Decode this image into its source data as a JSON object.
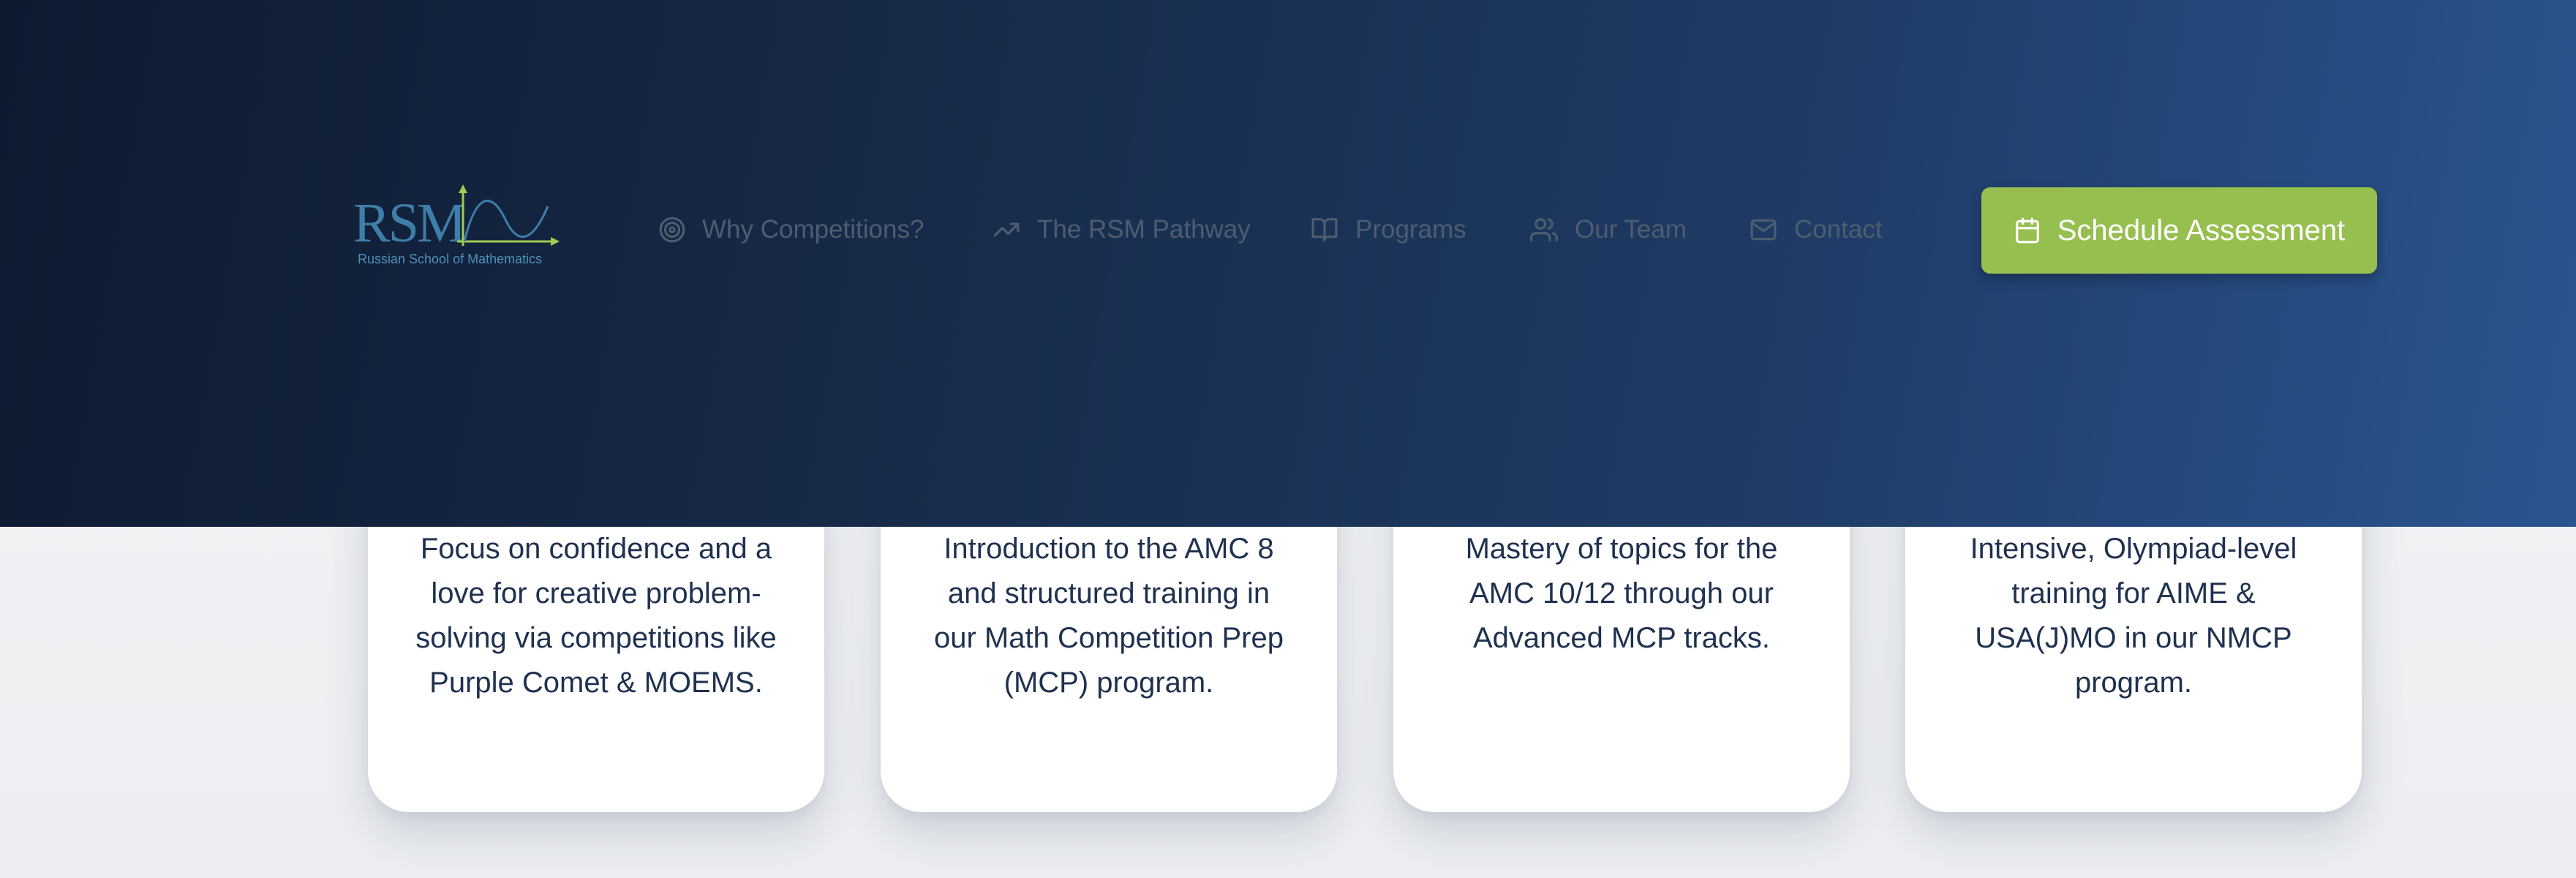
{
  "brand": {
    "logo_text": "RSM",
    "logo_subtitle": "Russian School of Mathematics",
    "colors": {
      "logo_blue": "#3e7ea8",
      "logo_green": "#9fcc52"
    }
  },
  "nav": {
    "items": [
      {
        "label": "Why Competitions?",
        "icon": "target-icon"
      },
      {
        "label": "The RSM Pathway",
        "icon": "trending-up-icon"
      },
      {
        "label": "Programs",
        "icon": "book-open-icon"
      },
      {
        "label": "Our Team",
        "icon": "users-icon"
      },
      {
        "label": "Contact",
        "icon": "mail-icon"
      }
    ]
  },
  "cta": {
    "label": "Schedule Assessment",
    "icon": "calendar-icon",
    "color": "#97bf4f"
  },
  "cards": [
    {
      "text": "Focus on confidence and a love for creative problem-solving via competitions like Purple Comet & MOEMS."
    },
    {
      "text": "Introduction to the AMC 8 and structured training in our Math Competition Prep (MCP) program."
    },
    {
      "text": "Mastery of topics for the AMC 10/12 through our Advanced MCP tracks."
    },
    {
      "text": "Intensive, Olympiad-level training for AIME & USA(J)MO in our NMCP program."
    }
  ]
}
